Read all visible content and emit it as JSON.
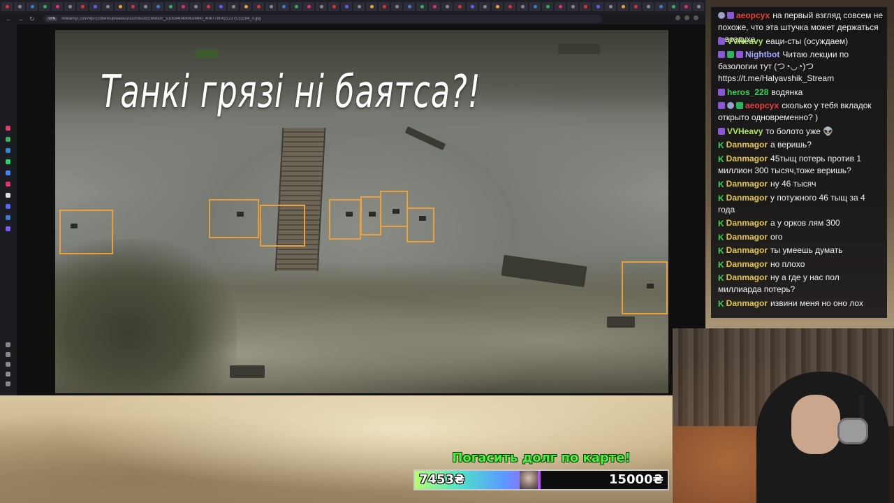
{
  "browser": {
    "url": "militarnyi.com/wp-content/uploads/2022/05/281089920_510594049042846​0_4967780421227513284_n.jpg",
    "url_badge": "VPN"
  },
  "photo": {
    "headline": "Танкі грязі ні баятса?!"
  },
  "chat": {
    "messages": [
      {
        "user": "аеорсух",
        "user_color": "#e8403a",
        "badges": [
          "round",
          "sub"
        ],
        "text": "на первый взгляд совсем не похоже, что эта штучка может держаться в воздухе"
      },
      {
        "user": "VVHeavy",
        "user_color": "#b0e65a",
        "badges": [
          "sub"
        ],
        "text": "еаци-сты (осуждаем)"
      },
      {
        "user": "Nightbot",
        "user_color": "#a3a8ff",
        "badges": [
          "sub",
          "green",
          "sub"
        ],
        "text": "Читаю лекции по базологии тут (つ◔◡◔)つ https://t.me/Halyavshik_Stream"
      },
      {
        "user": "heros_228",
        "user_color": "#3cd15a",
        "badges": [
          "sub"
        ],
        "text": "водянка"
      },
      {
        "user": "аеорсух",
        "user_color": "#e8403a",
        "badges": [
          "sub",
          "round",
          "green"
        ],
        "text": "сколько у тебя вкладок открыто одновременно? )"
      },
      {
        "user": "VVHeavy",
        "user_color": "#b0e65a",
        "badges": [
          "sub"
        ],
        "text": "то болото уже 👽"
      },
      {
        "user": "Danmagor",
        "user_color": "#e6c84a",
        "badges": [
          "k"
        ],
        "text": "а веришь?"
      },
      {
        "user": "Danmagor",
        "user_color": "#e6c84a",
        "badges": [
          "k"
        ],
        "text": "45тыщ потерь против 1 миллион 300 тысяч,тоже веришь?"
      },
      {
        "user": "Danmagor",
        "user_color": "#e6c84a",
        "badges": [
          "k"
        ],
        "text": "ну 46 тысяч"
      },
      {
        "user": "Danmagor",
        "user_color": "#e6c84a",
        "badges": [
          "k"
        ],
        "text": "у потужного 46 тыщ за 4 года"
      },
      {
        "user": "Danmagor",
        "user_color": "#e6c84a",
        "badges": [
          "k"
        ],
        "text": "а у орков лям 300"
      },
      {
        "user": "Danmagor",
        "user_color": "#e6c84a",
        "badges": [
          "k"
        ],
        "text": "ого"
      },
      {
        "user": "Danmagor",
        "user_color": "#e6c84a",
        "badges": [
          "k"
        ],
        "text": "ты умеешь думать"
      },
      {
        "user": "Danmagor",
        "user_color": "#e6c84a",
        "badges": [
          "k"
        ],
        "text": "но плохо"
      },
      {
        "user": "Danmagor",
        "user_color": "#e6c84a",
        "badges": [
          "k"
        ],
        "text": "ну а где у нас пол миллиарда потерь?"
      },
      {
        "user": "Danmagor",
        "user_color": "#e6c84a",
        "badges": [
          "k"
        ],
        "text": "извини меня но оно лох"
      }
    ]
  },
  "donation_goal": {
    "title": "Погасить долг по карте!",
    "current": "7453₴",
    "target": "15000₴",
    "progress_fraction": 0.497
  },
  "colors": {
    "mark_box": "#e9a13b",
    "goal_title": "#4ef03a"
  }
}
